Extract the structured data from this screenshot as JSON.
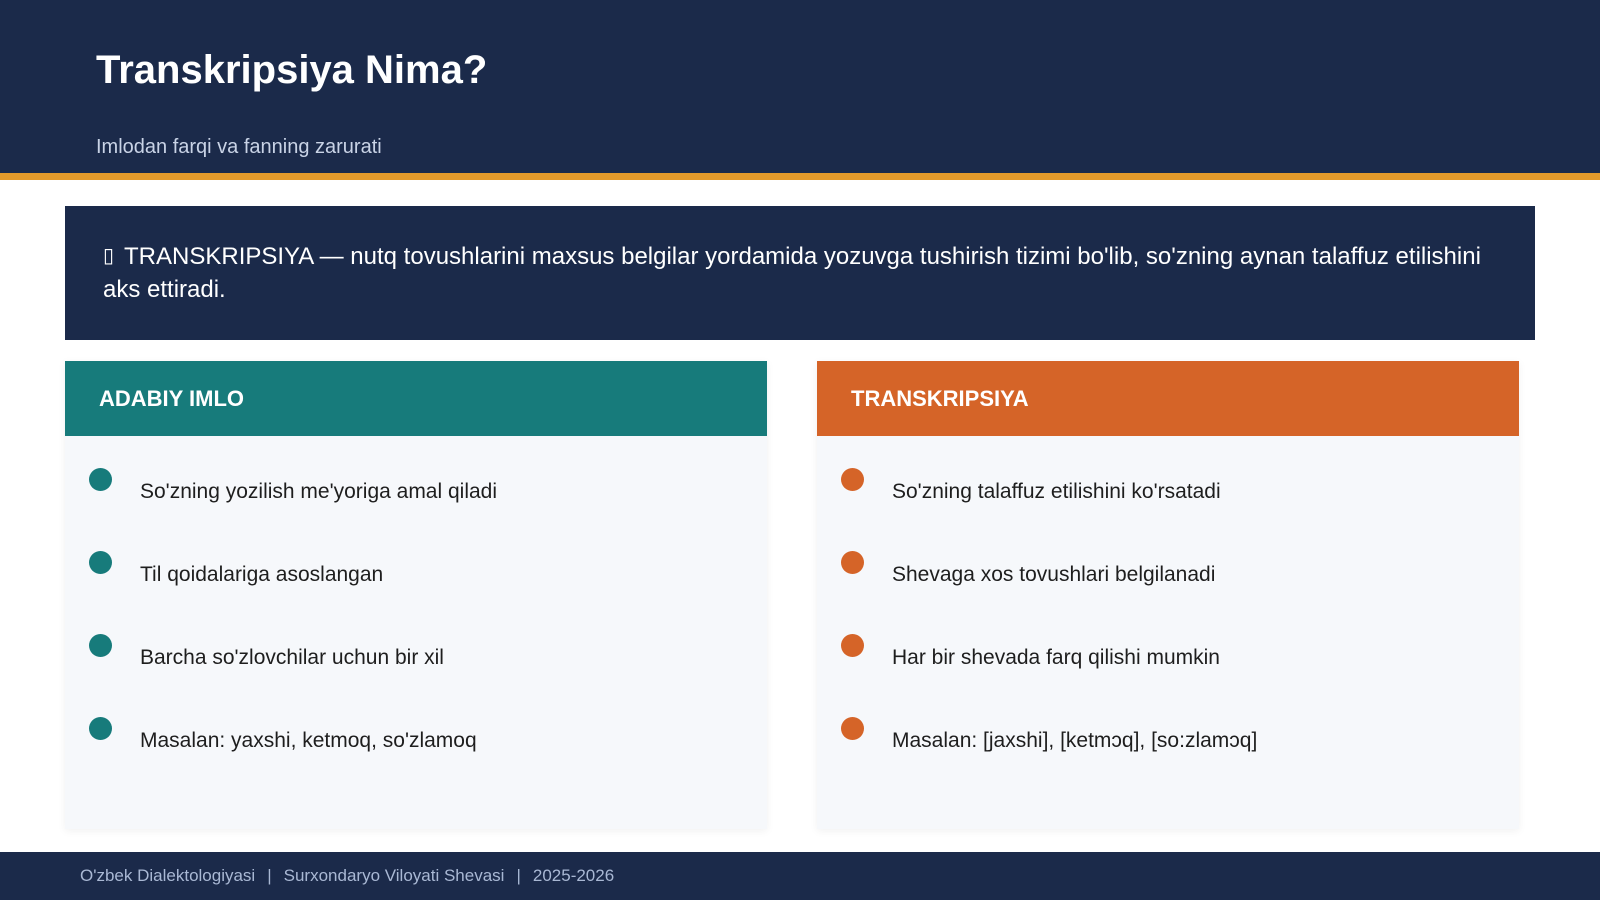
{
  "header": {
    "title": "Transkripsiya Nima?",
    "subtitle": "Imlodan farqi va fanning zarurati"
  },
  "definition": {
    "icon": "▯",
    "text": "TRANSKRIPSIYA — nutq tovushlarini maxsus belgilar yordamida yozuvga tushirish tizimi bo'lib, so'zning aynan talaffuz etilishini aks ettiradi."
  },
  "cards": {
    "left": {
      "title": "ADABIY IMLO",
      "items": [
        "So'zning yozilish me'yoriga amal qiladi",
        "Til qoidalariga asoslangan",
        "Barcha so'zlovchilar uchun bir xil",
        "Masalan: yaxshi, ketmoq, so'zlamoq"
      ]
    },
    "right": {
      "title": "TRANSKRIPSIYA",
      "items": [
        "So'zning talaffuz etilishini ko'rsatadi",
        "Shevaga xos tovushlari belgilanadi",
        "Har bir shevada farq qilishi mumkin",
        "Masalan: [jaxshi], [ketmɔq], [so:zlamɔq]"
      ]
    }
  },
  "footer": {
    "course": "O'zbek Dialektologiyasi",
    "separator": "|",
    "topic": "Surxondaryo Viloyati Shevasi",
    "year": "2025-2026"
  },
  "colors": {
    "navy": "#1b2a4a",
    "gold": "#e39a2b",
    "teal": "#177b7b",
    "orange": "#d56428"
  }
}
